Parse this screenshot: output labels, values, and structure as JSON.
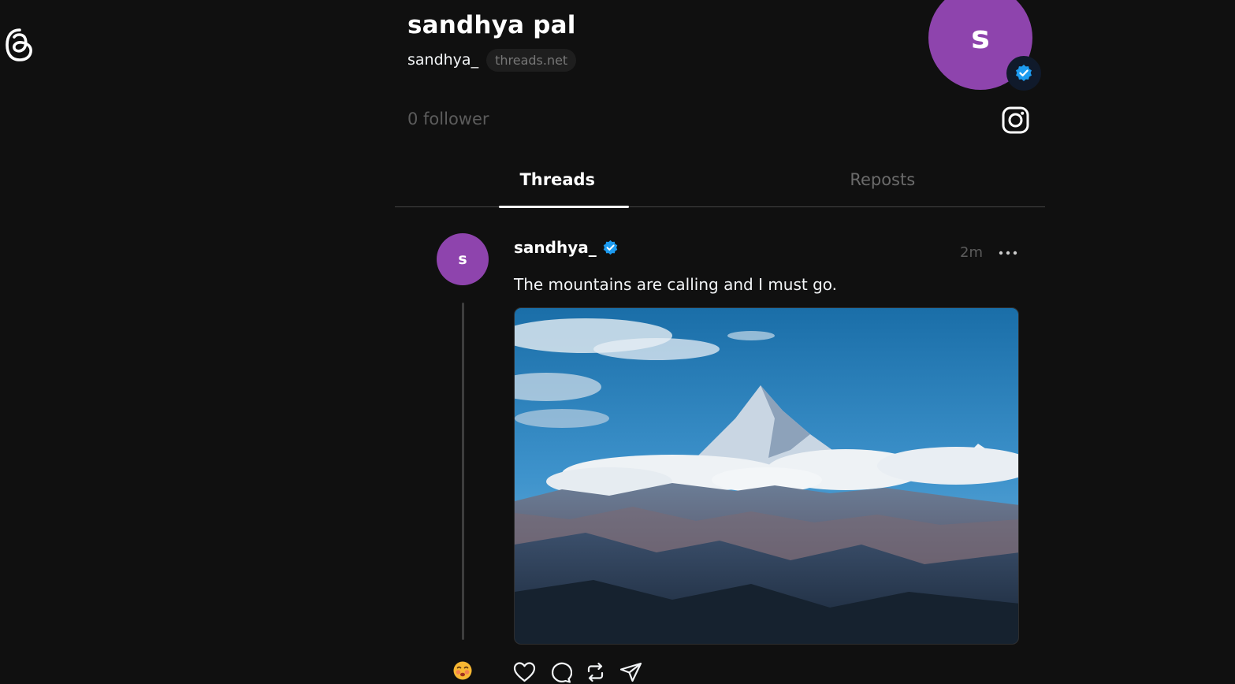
{
  "app": {
    "logo_icon": "threads-logo-icon"
  },
  "profile": {
    "name": "sandhya pal",
    "handle": "sandhya_",
    "domain": "threads.net",
    "avatar_initial": "s",
    "followers": "0 follower",
    "avatar_color": "#8e44ad",
    "verified_color": "#1d9bf0",
    "instagram_icon": "instagram-icon"
  },
  "tabs": [
    {
      "label": "Threads",
      "active": true
    },
    {
      "label": "Reposts",
      "active": false
    }
  ],
  "post": {
    "avatar_initial": "s",
    "username": "sandhya_",
    "time": "2m",
    "text": "The mountains are calling and I must go.",
    "image_icon": "mountain-photo",
    "reply_emoji_icon": "blushing-face-emoji-icon",
    "actions": [
      "heart-icon",
      "comment-icon",
      "repost-icon",
      "share-icon"
    ]
  }
}
